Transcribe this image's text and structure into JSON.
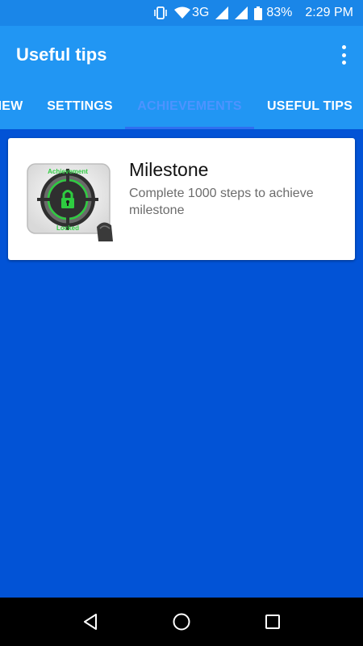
{
  "status_bar": {
    "battery": "83%",
    "time": "2:29 PM",
    "network": "3G",
    "icons": [
      "vibrate-icon",
      "wifi-icon",
      "signal-icon",
      "signal-icon",
      "battery-icon"
    ]
  },
  "app_bar": {
    "title": "Useful tips",
    "menu_icon": "overflow-menu-icon"
  },
  "tabs": [
    {
      "label": "IEW",
      "active": false
    },
    {
      "label": "SETTINGS",
      "active": false
    },
    {
      "label": "ACHIEVEMENTS",
      "active": true
    },
    {
      "label": "USEFUL TIPS",
      "active": false
    }
  ],
  "achievement": {
    "title": "Milestone",
    "description": "Complete 1000 steps to achieve milestone",
    "badge_top": "Achievement",
    "badge_bottom": "Locked",
    "icon": "achievement-locked-icon"
  },
  "nav_bar": {
    "icons": [
      "back-icon",
      "home-icon",
      "recents-icon"
    ]
  },
  "colors": {
    "status_bar": "#1a86e8",
    "app_bar": "#2196f3",
    "background": "#0253d6",
    "active_tab": "#4d93ff"
  }
}
